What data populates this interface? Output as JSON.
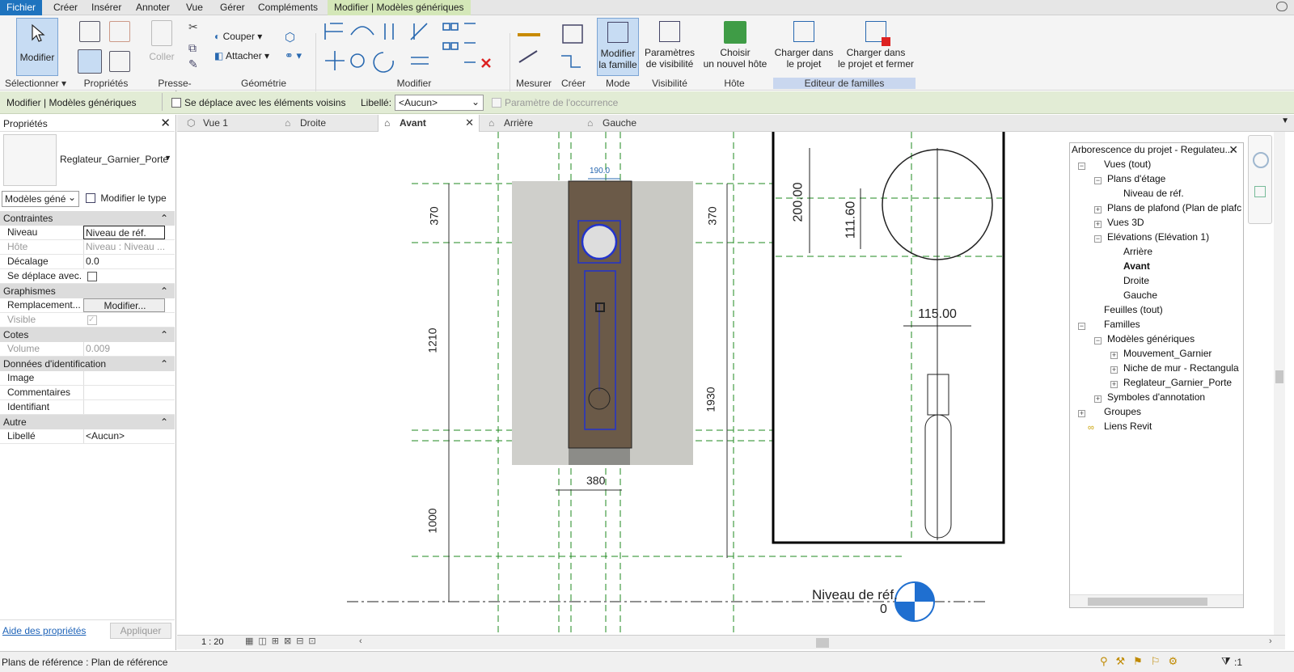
{
  "menu": {
    "items": [
      "Fichier",
      "Créer",
      "Insérer",
      "Annoter",
      "Vue",
      "Gérer",
      "Compléments",
      "Modifier | Modèles génériques"
    ]
  },
  "ribbon": {
    "modify_label": "Modifier",
    "paste_label": "Coller",
    "cut_label": "Couper",
    "attach_label": "Attacher",
    "edit_family_line1": "Modifier",
    "edit_family_line2": "la famille",
    "visibility_line1": "Paramètres",
    "visibility_line2": "de visibilité",
    "host_line1": "Choisir",
    "host_line2": "un nouvel hôte",
    "load_line1": "Charger dans",
    "load_line2": "le projet",
    "load_close_line1": "Charger dans",
    "load_close_line2": "le projet et fermer",
    "panels": {
      "select": "Sélectionner",
      "properties": "Propriétés",
      "clipboard": "Presse-papiers",
      "geometry": "Géométrie",
      "modify": "Modifier",
      "measure": "Mesurer",
      "create": "Créer",
      "mode": "Mode",
      "visibility": "Visibilité",
      "host": "Hôte",
      "family_editor": "Editeur de familles"
    }
  },
  "options": {
    "context": "Modifier | Modèles génériques",
    "moves_with": "Se déplace avec les éléments voisins",
    "label": "Libellé:",
    "label_value": "<Aucun>",
    "instance_param": "Paramètre de l'occurrence"
  },
  "properties": {
    "title": "Propriétés",
    "type_name": "Reglateur_Garnier_Porte",
    "filter": "Modèles géné",
    "edit_type": "Modifier le type",
    "sections": {
      "constraints": "Contraintes",
      "graphics": "Graphismes",
      "dimensions": "Cotes",
      "identity": "Données d'identification",
      "other": "Autre"
    },
    "rows": {
      "niveau": {
        "label": "Niveau",
        "value": "Niveau de réf."
      },
      "hote": {
        "label": "Hôte",
        "value": "Niveau : Niveau ..."
      },
      "decalage": {
        "label": "Décalage",
        "value": "0.0"
      },
      "deplace": {
        "label": "Se déplace avec..."
      },
      "remplacement": {
        "label": "Remplacement...",
        "value": "Modifier..."
      },
      "visible": {
        "label": "Visible"
      },
      "volume": {
        "label": "Volume",
        "value": "0.009"
      },
      "image": {
        "label": "Image",
        "value": ""
      },
      "commentaires": {
        "label": "Commentaires",
        "value": ""
      },
      "identifiant": {
        "label": "Identifiant",
        "value": ""
      },
      "libelle": {
        "label": "Libellé",
        "value": "<Aucun>"
      }
    },
    "help": "Aide des propriétés",
    "apply": "Appliquer"
  },
  "tabs": [
    "Vue 1",
    "Droite",
    "Avant",
    "Arrière",
    "Gauche"
  ],
  "active_tab": "Avant",
  "drawing": {
    "dim_190": "190.0",
    "dim_370_left": "370",
    "dim_1210": "1210",
    "dim_1000": "1000",
    "dim_370_right": "370",
    "dim_1930": "1930",
    "dim_380": "380",
    "level_name": "Niveau de réf.",
    "level_value": "0",
    "detail_200": "200.00",
    "detail_111": "111.60",
    "detail_115": "115.00"
  },
  "browser": {
    "title": "Arborescence du projet - Regulateu...",
    "items": {
      "views": "Vues (tout)",
      "floor_plans": "Plans d'étage",
      "ref_level": "Niveau de réf.",
      "ceiling_plans": "Plans de plafond (Plan de plafc",
      "views3d": "Vues 3D",
      "elevations": "Elévations (Elévation 1)",
      "back": "Arrière",
      "front": "Avant",
      "right": "Droite",
      "left": "Gauche",
      "sheets": "Feuilles (tout)",
      "families": "Familles",
      "generic_models": "Modèles génériques",
      "mouvement": "Mouvement_Garnier",
      "niche": "Niche de mur - Rectangula",
      "reglateur": "Reglateur_Garnier_Porte",
      "annotation": "Symboles d'annotation",
      "groups": "Groupes",
      "revit_links": "Liens Revit"
    }
  },
  "viewctl": {
    "scale": "1 : 20"
  },
  "status": {
    "text": "Plans de référence : Plan de référence",
    "filter_count": ":1"
  },
  "colors": {
    "accent": "#1e73be",
    "context_tab": "#d4e7b8",
    "refplane": "#1f8a1f",
    "selection": "#2233cc"
  }
}
